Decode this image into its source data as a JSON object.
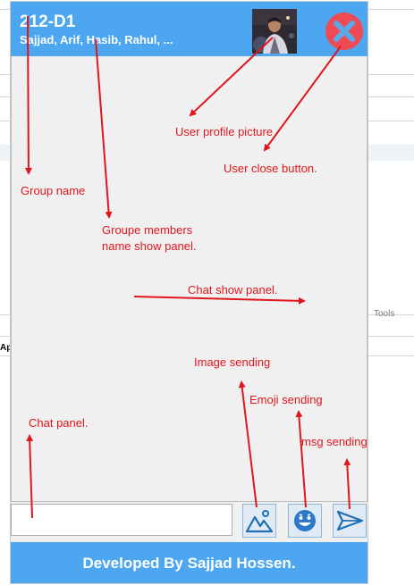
{
  "window": {
    "group_name": "212-D1",
    "members": "Sajjad, Arif, Hasib, Rahul, ...",
    "footer_text": "Developed By Sajjad Hossen.",
    "input_placeholder": ""
  },
  "background": {
    "tools_text": "Tools",
    "ap_text": "Ap"
  },
  "annotations": {
    "user_profile_picture": "User profile picture",
    "user_close_button": "User close button.",
    "group_name": "Group name",
    "members_panel_line1": "Groupe members",
    "members_panel_line2": "name show panel.",
    "chat_show_panel": "Chat show panel.",
    "image_sending": "Image sending",
    "emoji_sending": "Emoji sending",
    "chat_panel": "Chat panel.",
    "msg_sending": "msg sending"
  },
  "colors": {
    "header_blue": "#4da6f0",
    "close_red": "#ef4b55",
    "annotation_red": "#e0161c"
  },
  "icons": [
    "avatar-image",
    "close-icon",
    "image-icon",
    "emoji-icon",
    "send-icon"
  ]
}
